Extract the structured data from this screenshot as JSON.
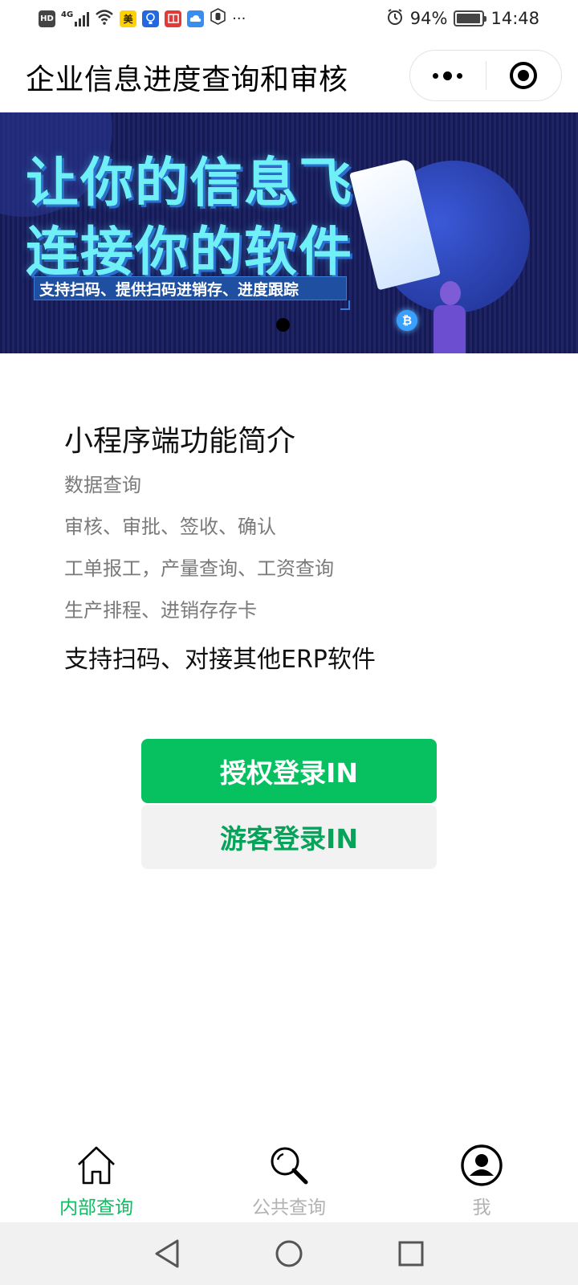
{
  "status_bar": {
    "network": "4G",
    "battery_text": "94%",
    "battery_level": 0.94,
    "time": "14:48",
    "hd_badge": "HD",
    "app_badge_mei": "美",
    "more": "···"
  },
  "header": {
    "title": "企业信息进度查询和审核"
  },
  "banner": {
    "headline_line1": "让你的信息飞",
    "headline_line2": "连接你的软件",
    "tagline": "支持扫码、提供扫码进销存、进度跟踪",
    "coin_symbol": "₿"
  },
  "intro": {
    "title": "小程序端功能简介",
    "lines": [
      "数据查询",
      "审核、审批、签收、确认",
      "工单报工，产量查询、工资查询",
      "生产排程、进销存存卡"
    ],
    "highlight": "支持扫码、对接其他ERP软件"
  },
  "buttons": {
    "auth_login": "授权登录IN",
    "guest_login": "游客登录IN"
  },
  "tabbar": {
    "items": [
      {
        "label": "内部查询",
        "icon": "home-icon",
        "active": true
      },
      {
        "label": "公共查询",
        "icon": "search-icon",
        "active": false
      },
      {
        "label": "我",
        "icon": "user-icon",
        "active": false
      }
    ]
  },
  "colors": {
    "accent_green": "#07c160",
    "banner_bg": "#151a55",
    "banner_text": "#6ff0f6"
  }
}
